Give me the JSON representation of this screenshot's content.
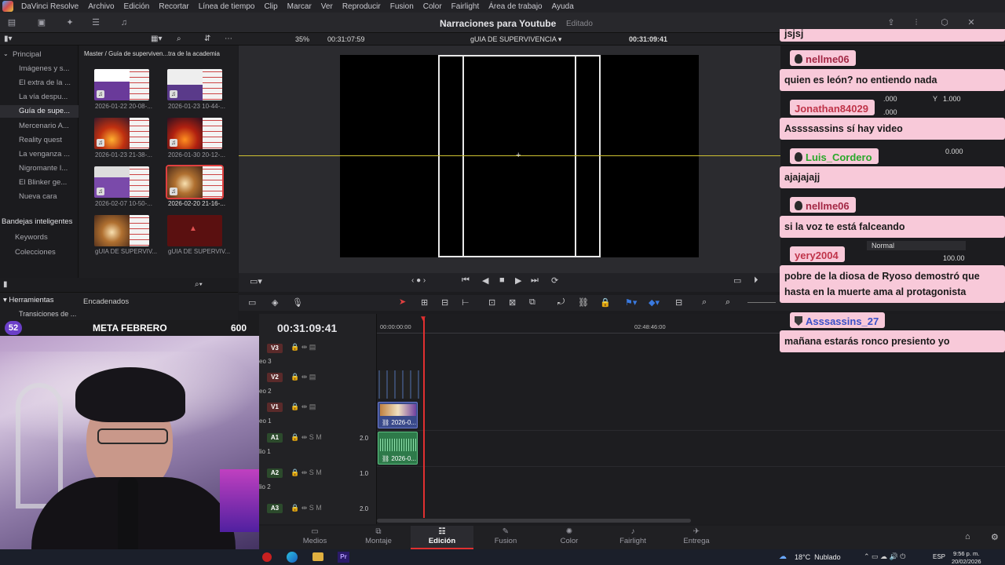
{
  "menubar": {
    "items": [
      "DaVinci Resolve",
      "Archivo",
      "Edición",
      "Recortar",
      "Línea de tiempo",
      "Clip",
      "Marcar",
      "Ver",
      "Reproducir",
      "Fusion",
      "Color",
      "Fairlight",
      "Área de trabajo",
      "Ayuda"
    ]
  },
  "project": {
    "title": "Narraciones para Youtube",
    "status": "Editado"
  },
  "viewer": {
    "zoom": "35%",
    "source_timecode": "00:31:07:59",
    "timeline_name": "gUIA DE SUPERVIVENCIA",
    "timeline_timecode": "00:31:09:41"
  },
  "media_pool": {
    "path": "Master / Guía de superviven...tra de la academia",
    "bins": [
      "Principal",
      "Imágenes y s...",
      "El extra de la ...",
      "La vía despu...",
      "Guía de supe...",
      "Mercenario A...",
      "Reality quest",
      "La venganza ...",
      "Nigromante I...",
      "El Blinker ge...",
      "Nueva cara"
    ],
    "selected_bin": "Guía de supe...",
    "smart_bins_title": "Bandejas inteligentes",
    "smart_bins": [
      "Keywords",
      "Colecciones"
    ],
    "clips": [
      "2026-01-22 20-08-...",
      "2026-01-23 10-44-...",
      "2026-01-23 21-38-...",
      "2026-01-30 20-12-...",
      "2026-02-07 10-50-...",
      "2026-02-20 21-16-...",
      "gUIA DE SUPERVIV...",
      "gUIA DE SUPERVIV..."
    ]
  },
  "tools": {
    "title": "Herramientas",
    "item": "Transiciones de ...",
    "item2": "Transiciones de ...",
    "chained": "Encadenados"
  },
  "goal": {
    "count": "52",
    "label": "META FEBRERO",
    "target": "600"
  },
  "timeline": {
    "timecode": "00:31:09:41",
    "ruler": [
      "00:00:00:00",
      "02:48:46:00"
    ],
    "tracks": [
      {
        "id": "V3",
        "name": "eo 3"
      },
      {
        "id": "V2",
        "name": "eo 2"
      },
      {
        "id": "V1",
        "name": "eo 1"
      },
      {
        "id": "A1",
        "name": "lio 1",
        "level": "2.0"
      },
      {
        "id": "A2",
        "name": "lio 2",
        "level": "1.0"
      },
      {
        "id": "A3",
        "name": "",
        "level": "2.0"
      }
    ],
    "clip_label": "2026-0..."
  },
  "inspector": {
    "x_label": "Y",
    "x_val": ".000",
    "y_val": "1.000",
    "val2": ".000",
    "val3": "0.000",
    "blend": "Normal",
    "opacity": "100.00",
    "reset": "Reseto",
    "modo": "odo",
    "dad": "dad"
  },
  "pages": [
    "Medios",
    "Montaje",
    "Edición",
    "Fusion",
    "Color",
    "Fairlight",
    "Entrega"
  ],
  "active_page": "Edición",
  "chat": [
    {
      "user": "",
      "msg": "jsjsj"
    },
    {
      "user": "nellme06",
      "msg": "quien es león? no entiendo nada",
      "color": "#a32845"
    },
    {
      "user": "Jonathan84029",
      "msg": "Assssassins sí hay video",
      "color": "#c0344a"
    },
    {
      "user": "Luis_Cordero",
      "msg": "ajajajajj",
      "color": "#2aa82a"
    },
    {
      "user": "nellme06",
      "msg": "si la voz te está falceando",
      "color": "#a32845"
    },
    {
      "user": "yery2004",
      "msg": "pobre de la diosa de Ryoso demostró que hasta en la muerte ama al protagonista",
      "color": "#c0344a"
    },
    {
      "user": "Asssassins_27",
      "msg": "mañana estarás ronco presiento yo",
      "color": "#3a50c8"
    }
  ],
  "taskbar": {
    "weather": "18°C  Nublado",
    "lang": "ESP",
    "time": "9:56 p. m.",
    "date": "20/02/2026",
    "app": "Pr"
  }
}
